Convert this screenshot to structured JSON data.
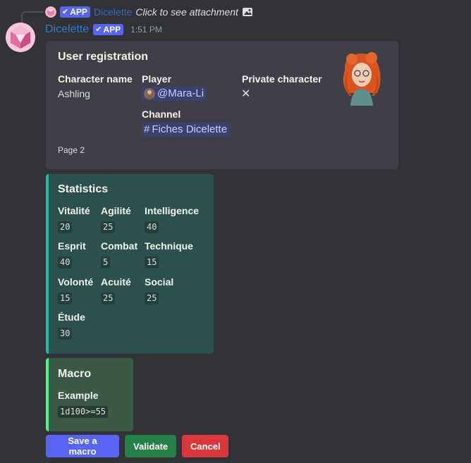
{
  "reply": {
    "app_badge": "APP",
    "author": "Dicelette",
    "text": "Click to see attachment"
  },
  "message": {
    "author": "Dicelette",
    "app_badge": "APP",
    "timestamp": "1:51 PM"
  },
  "registration": {
    "title": "User registration",
    "fields": {
      "character_name": {
        "label": "Character name",
        "value": "Ashling"
      },
      "player": {
        "label": "Player",
        "value": "@Mara-Li"
      },
      "private_character": {
        "label": "Private character",
        "icon": "x-icon"
      },
      "channel": {
        "label": "Channel",
        "value": "Fiches Dicelette"
      }
    },
    "footer": "Page 2"
  },
  "statistics": {
    "title": "Statistics",
    "accent": "#1abc9c",
    "stats": [
      {
        "label": "Vitalité",
        "value": "20"
      },
      {
        "label": "Agilité",
        "value": "25"
      },
      {
        "label": "Intelligence",
        "value": "40"
      },
      {
        "label": "Esprit",
        "value": "40"
      },
      {
        "label": "Combat",
        "value": "5"
      },
      {
        "label": "Technique",
        "value": "15"
      },
      {
        "label": "Volonté",
        "value": "15"
      },
      {
        "label": "Acuité",
        "value": "25"
      },
      {
        "label": "Social",
        "value": "25"
      },
      {
        "label": "Étude",
        "value": "30"
      }
    ]
  },
  "macro": {
    "title": "Macro",
    "accent": "#57f287",
    "name": "Example",
    "value": "1d100>=55"
  },
  "buttons": {
    "save_macro": "Save a macro",
    "validate": "Validate",
    "cancel": "Cancel"
  }
}
